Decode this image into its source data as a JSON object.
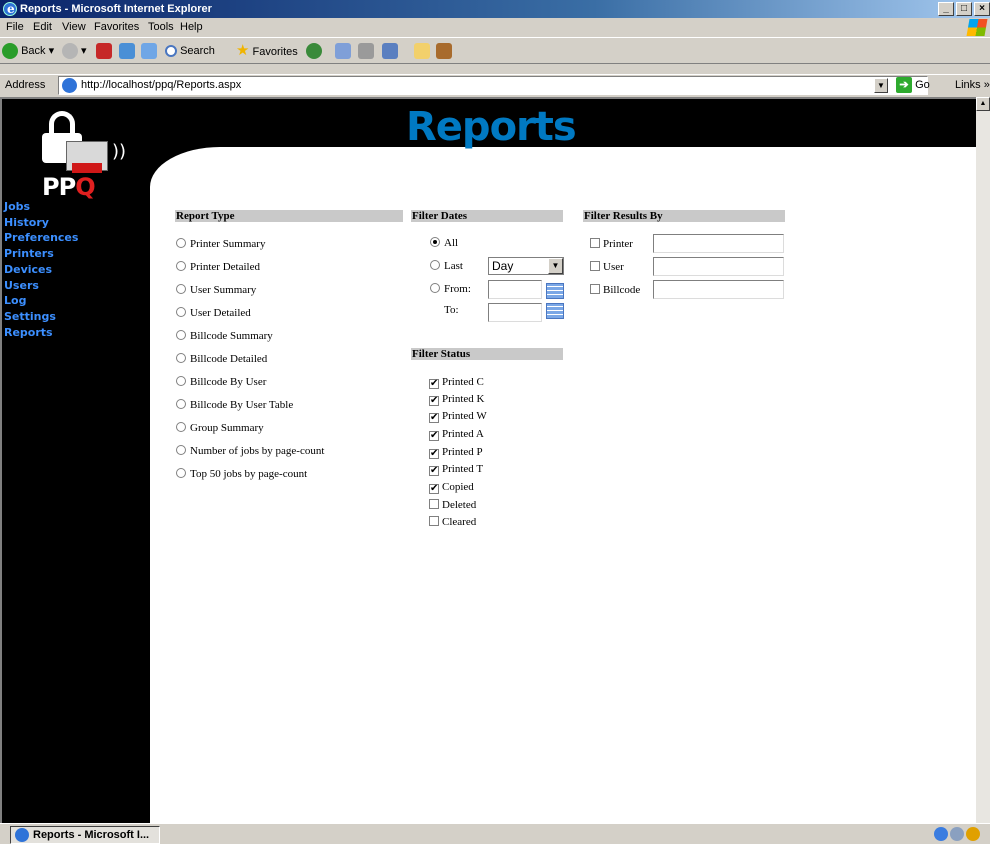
{
  "window": {
    "title": "Reports - Microsoft Internet Explorer",
    "minimize": "_",
    "maximize": "□",
    "close": "×"
  },
  "menu": [
    "File",
    "Edit",
    "View",
    "Favorites",
    "Tools",
    "Help"
  ],
  "toolbar": {
    "back": "Back",
    "search": "Search",
    "favorites": "Favorites",
    "links": "Links",
    "links_more": "»"
  },
  "address": {
    "label": "Address",
    "url": "http://localhost/ppq/Reports.aspx",
    "go": "Go"
  },
  "page": {
    "title": "Reports"
  },
  "logo": {
    "text_pp": "PP",
    "text_q": "Q",
    "waves": "))"
  },
  "nav": [
    "Jobs",
    "History",
    "Preferences",
    "Printers",
    "Devices",
    "Users",
    "Log",
    "Settings",
    "Reports"
  ],
  "report_type": {
    "header": "Report Type",
    "options": [
      "Printer Summary",
      "Printer Detailed",
      "User Summary",
      "User Detailed",
      "Billcode Summary",
      "Billcode Detailed",
      "Billcode By User",
      "Billcode By User Table",
      "Group Summary",
      "Number of jobs by page-count",
      "Top 50 jobs by page-count"
    ]
  },
  "filter_dates": {
    "header": "Filter Dates",
    "all_label": "All",
    "last_label": "Last",
    "from_label": "From:",
    "to_label": "To:",
    "last_value": "Day",
    "from_value": "",
    "to_value": "",
    "selected": "All"
  },
  "filter_results": {
    "header": "Filter Results By",
    "printer_label": "Printer",
    "user_label": "User",
    "billcode_label": "Billcode",
    "printer_checked": false,
    "user_checked": false,
    "billcode_checked": false,
    "printer_value": "",
    "user_value": "",
    "billcode_value": ""
  },
  "filter_status": {
    "header": "Filter Status",
    "items": [
      {
        "label": "Printed C",
        "checked": true
      },
      {
        "label": "Printed K",
        "checked": true
      },
      {
        "label": "Printed W",
        "checked": true
      },
      {
        "label": "Printed A",
        "checked": true
      },
      {
        "label": "Printed P",
        "checked": true
      },
      {
        "label": "Printed T",
        "checked": true
      },
      {
        "label": "Copied",
        "checked": true
      },
      {
        "label": "Deleted",
        "checked": false
      },
      {
        "label": "Cleared",
        "checked": false
      }
    ]
  },
  "taskbar": {
    "item": "Reports - Microsoft I..."
  },
  "colors": {
    "title_blue": "#0079c2",
    "nav_blue": "#3c8fff",
    "section_gray": "#c9c9c9",
    "logo_red": "#e02020"
  }
}
